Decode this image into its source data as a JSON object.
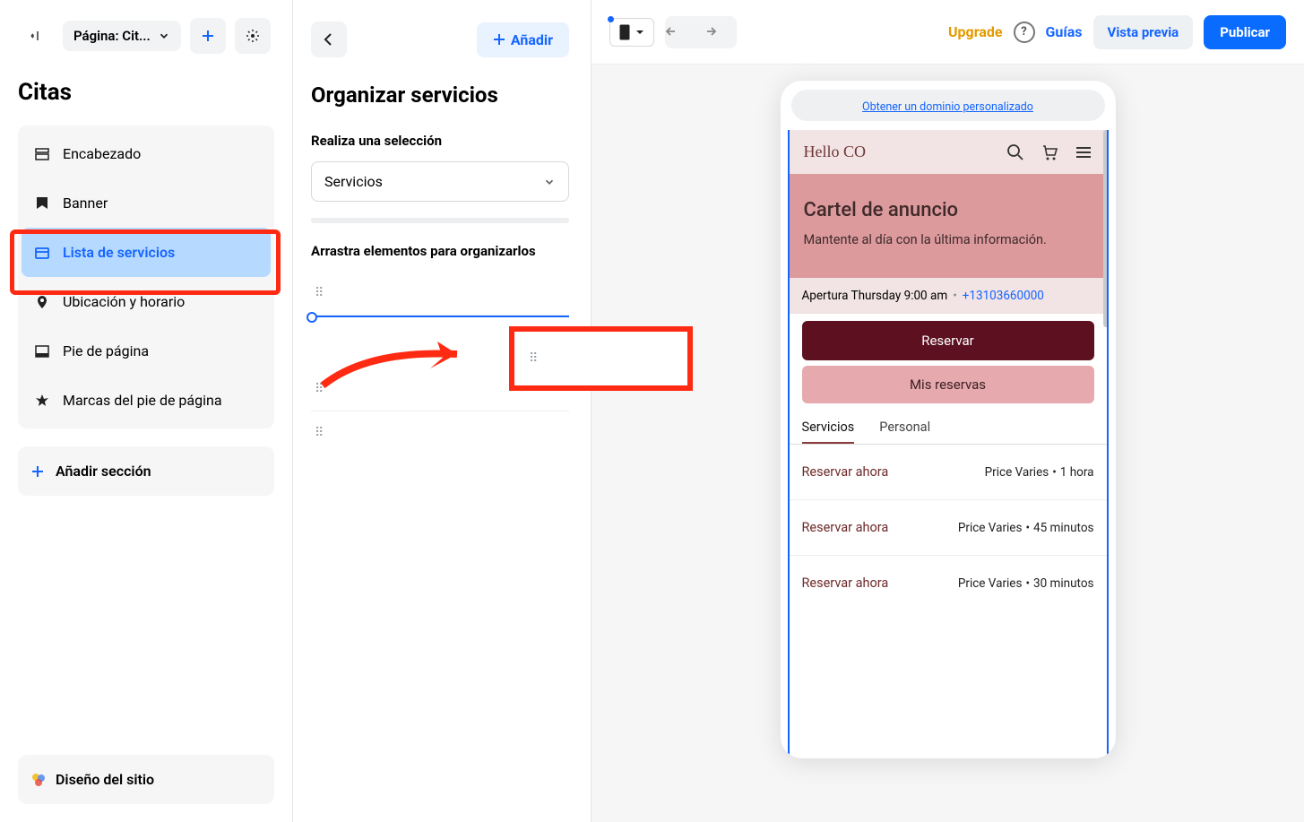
{
  "leftbar": {
    "page_dropdown": "Página: Cit...",
    "title": "Citas",
    "sections": {
      "header": "Encabezado",
      "banner": "Banner",
      "services_list": "Lista de servicios",
      "location": "Ubicación y horario",
      "footer": "Pie de página",
      "footer_brands": "Marcas del pie de página"
    },
    "add_section": "Añadir sección",
    "design": "Diseño del sitio"
  },
  "midpanel": {
    "title": "Organizar servicios",
    "subtitle": "Realiza una selección",
    "select_value": "Servicios",
    "drag_hint": "Arrastra elementos para organizarlos",
    "add_button": "Añadir"
  },
  "topbar": {
    "upgrade": "Upgrade",
    "guides": "Guías",
    "preview": "Vista previa",
    "publish": "Publicar"
  },
  "preview": {
    "domain_link": "Obtener un dominio personalizado",
    "brand": "Hello CO",
    "banner_title": "Cartel de anuncio",
    "banner_text": "Mantente al día con la última información.",
    "hours_text": "Apertura Thursday 9:00 am",
    "phone": "+13103660000",
    "reserve": "Reservar",
    "my_reservations": "Mis reservas",
    "tab_services": "Servicios",
    "tab_staff": "Personal",
    "book_now": "Reservar ahora",
    "price_label": "Price Varies",
    "rows": [
      {
        "duration": "1 hora"
      },
      {
        "duration": "45 minutos"
      },
      {
        "duration": "30 minutos"
      }
    ]
  }
}
